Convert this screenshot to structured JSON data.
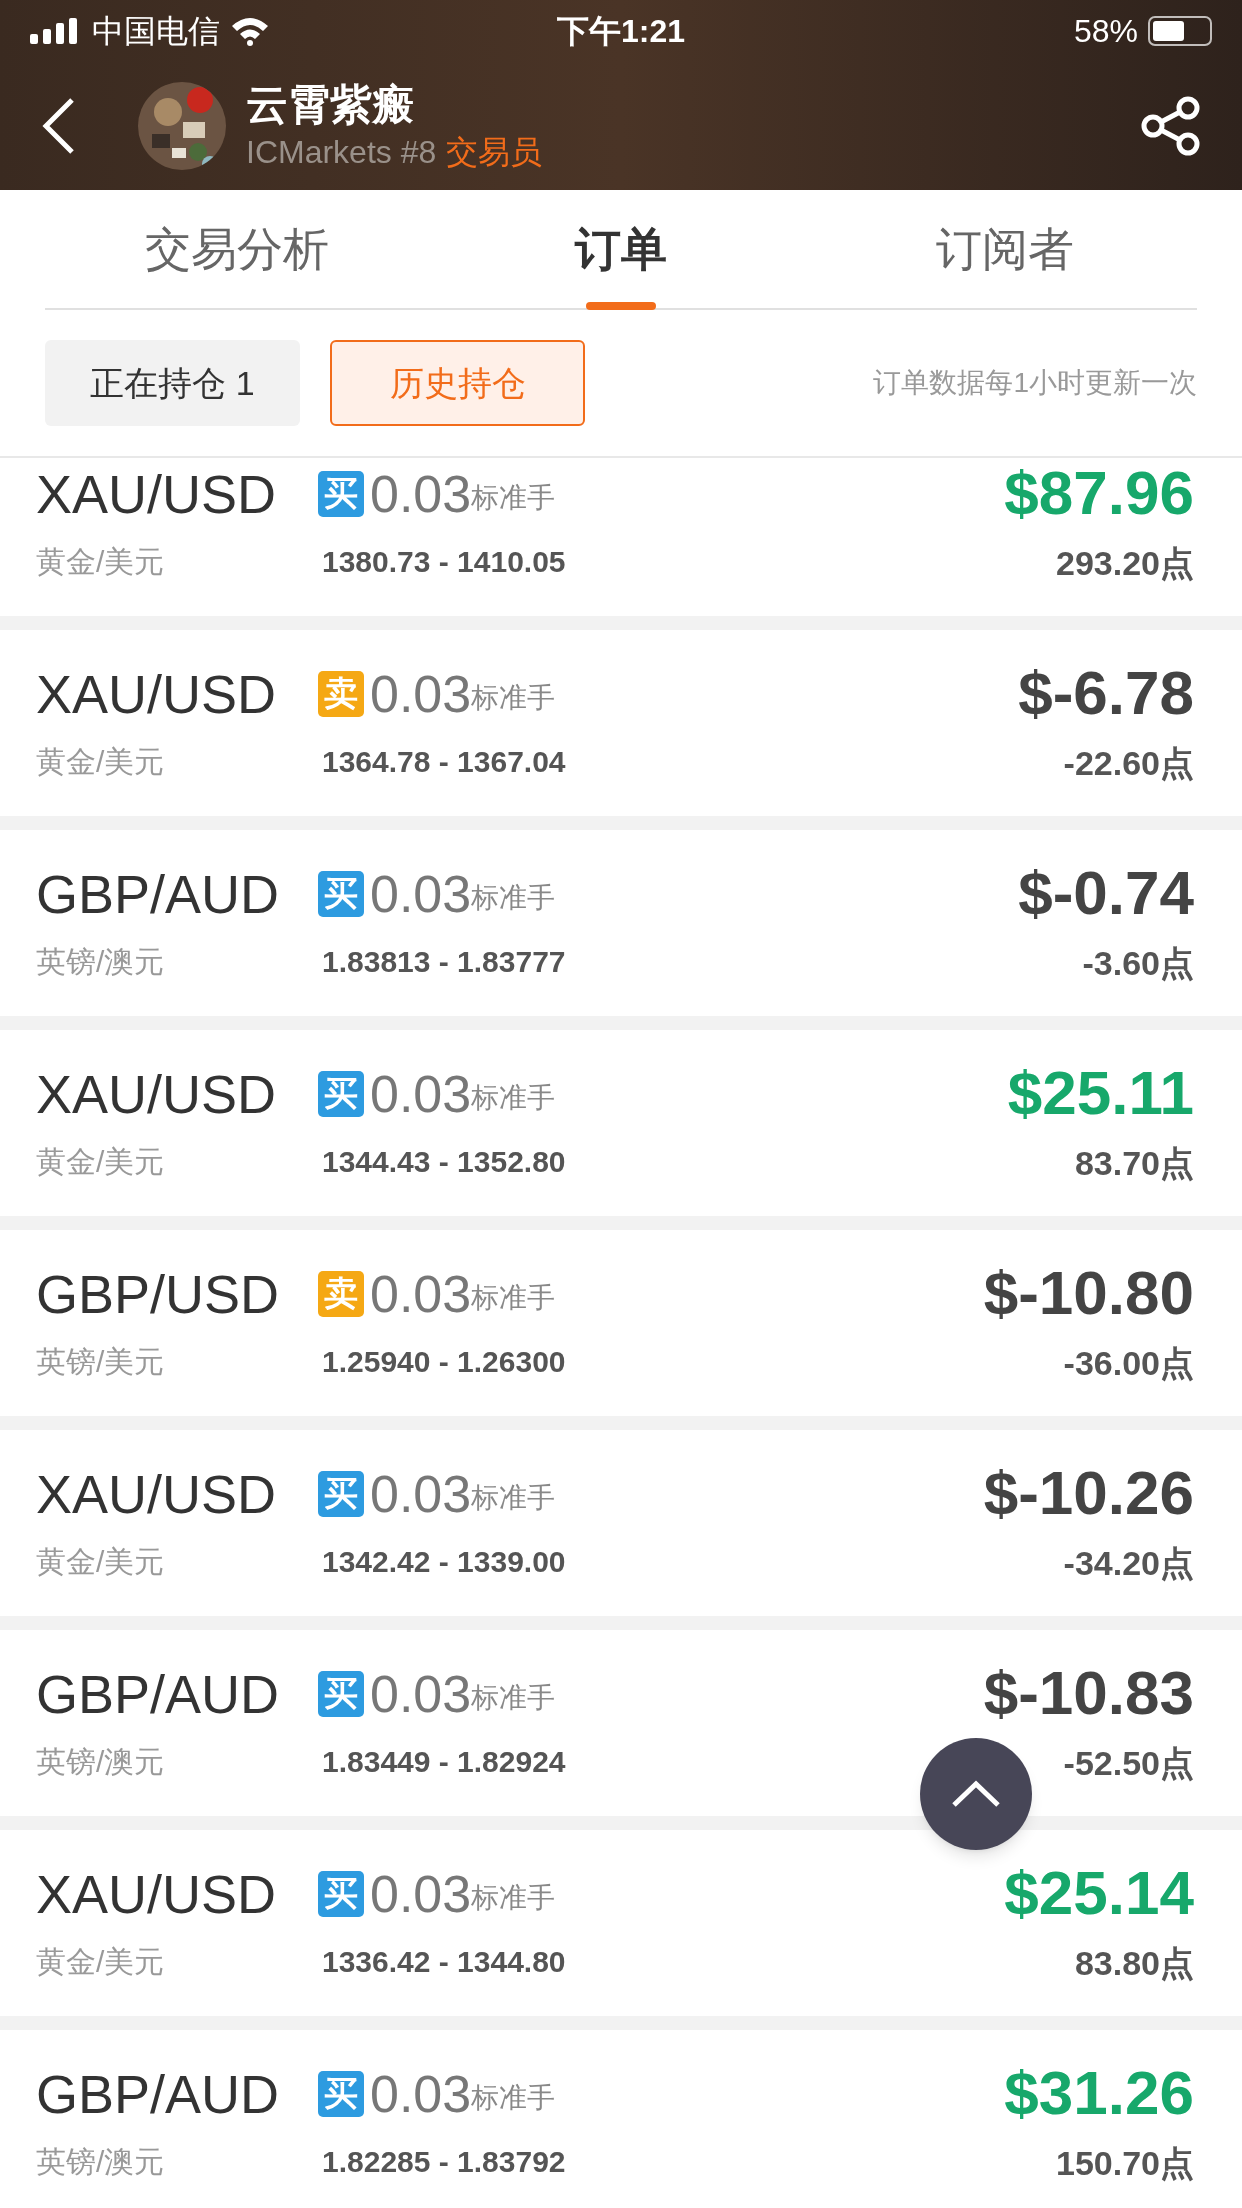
{
  "status_bar": {
    "carrier": "中国电信",
    "time": "下午1:21",
    "battery": "58%"
  },
  "header": {
    "name": "云霄紫瘢",
    "broker": "ICMarkets #8",
    "role": "交易员"
  },
  "tabs": [
    {
      "label": "交易分析",
      "selected": false
    },
    {
      "label": "订单",
      "selected": true
    },
    {
      "label": "订阅者",
      "selected": false
    }
  ],
  "filters": [
    {
      "label": "正在持仓 1",
      "selected": false
    },
    {
      "label": "历史持仓",
      "selected": true
    }
  ],
  "update_note": "订单数据每1小时更新一次",
  "orders": [
    {
      "pair": "XAU/USD",
      "side": "买",
      "kind": "buy",
      "lots": "0.03",
      "unit": "标准手",
      "name": "黄金/美元",
      "prices": "1380.73 - 1410.05",
      "profit": "$87.96",
      "gain": true,
      "points": "293.20点"
    },
    {
      "pair": "XAU/USD",
      "side": "卖",
      "kind": "sell",
      "lots": "0.03",
      "unit": "标准手",
      "name": "黄金/美元",
      "prices": "1364.78 - 1367.04",
      "profit": "$-6.78",
      "gain": false,
      "points": "-22.60点"
    },
    {
      "pair": "GBP/AUD",
      "side": "买",
      "kind": "buy",
      "lots": "0.03",
      "unit": "标准手",
      "name": "英镑/澳元",
      "prices": "1.83813 - 1.83777",
      "profit": "$-0.74",
      "gain": false,
      "points": "-3.60点"
    },
    {
      "pair": "XAU/USD",
      "side": "买",
      "kind": "buy",
      "lots": "0.03",
      "unit": "标准手",
      "name": "黄金/美元",
      "prices": "1344.43 - 1352.80",
      "profit": "$25.11",
      "gain": true,
      "points": "83.70点"
    },
    {
      "pair": "GBP/USD",
      "side": "卖",
      "kind": "sell",
      "lots": "0.03",
      "unit": "标准手",
      "name": "英镑/美元",
      "prices": "1.25940 - 1.26300",
      "profit": "$-10.80",
      "gain": false,
      "points": "-36.00点"
    },
    {
      "pair": "XAU/USD",
      "side": "买",
      "kind": "buy",
      "lots": "0.03",
      "unit": "标准手",
      "name": "黄金/美元",
      "prices": "1342.42 - 1339.00",
      "profit": "$-10.26",
      "gain": false,
      "points": "-34.20点"
    },
    {
      "pair": "GBP/AUD",
      "side": "买",
      "kind": "buy",
      "lots": "0.03",
      "unit": "标准手",
      "name": "英镑/澳元",
      "prices": "1.83449 - 1.82924",
      "profit": "$-10.83",
      "gain": false,
      "points": "-52.50点"
    },
    {
      "pair": "XAU/USD",
      "side": "买",
      "kind": "buy",
      "lots": "0.03",
      "unit": "标准手",
      "name": "黄金/美元",
      "prices": "1336.42 - 1344.80",
      "profit": "$25.14",
      "gain": true,
      "points": "83.80点"
    },
    {
      "pair": "GBP/AUD",
      "side": "买",
      "kind": "buy",
      "lots": "0.03",
      "unit": "标准手",
      "name": "英镑/澳元",
      "prices": "1.82285 - 1.83792",
      "profit": "$31.26",
      "gain": true,
      "points": "150.70点"
    }
  ]
}
